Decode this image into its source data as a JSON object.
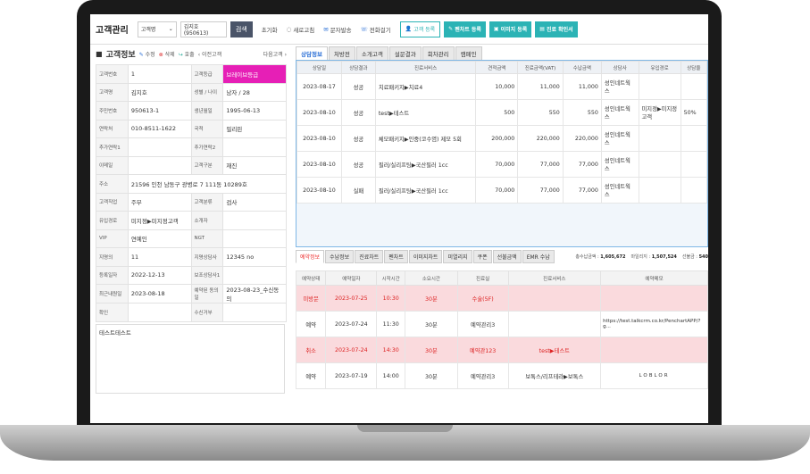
{
  "header": {
    "app_title": "고객관리",
    "search_select": "고객명",
    "search_value": "김지호 (950613)",
    "search_button": "검색",
    "links": [
      "초기화",
      "새로고침",
      "문자발송",
      "전화걸기"
    ],
    "btn_register": "고객 등록",
    "btn_register_rx": "펜차트 등록",
    "btn_image": "이미지 등록",
    "btn_confirm": "진료 확인서"
  },
  "left": {
    "title": "고객정보",
    "edit": "수정",
    "delete": "삭제",
    "transfer": "호출",
    "prev": "이전고객",
    "next": "다음고객",
    "rows": [
      [
        "고객번호",
        "1",
        "고객등급",
        "브레이브등급"
      ],
      [
        "고객명",
        "김지호",
        "성별 / 나이",
        "남자 / 28"
      ],
      [
        "주민번호",
        "950613-1",
        "생년월일",
        "1995-06-13"
      ],
      [
        "연락처",
        "010-8511-1622",
        "국적",
        "필리핀"
      ],
      [
        "추가연락1",
        "",
        "추가연락2",
        ""
      ],
      [
        "이메일",
        "",
        "고객구분",
        "재진"
      ],
      [
        "주소",
        "21596 인천 남동구 광병로 7 111동 10289호",
        "",
        ""
      ],
      [
        "고객직업",
        "주부",
        "고객분류",
        "검사"
      ],
      [
        "유입경로",
        "미지정▶미지정고객",
        "소개자",
        ""
      ],
      [
        "VIP",
        "연예인",
        "NGT",
        ""
      ],
      [
        "지명의",
        "11",
        "지명상담사",
        "12345 no"
      ],
      [
        "등록일자",
        "2022-12-13",
        "보조상담사1",
        ""
      ],
      [
        "최근내원일",
        "2023-08-18",
        "예약된 동의일",
        "2023-08-23_수신동의"
      ],
      [
        "확인",
        "",
        "수신거부",
        ""
      ]
    ],
    "memo": "테스트테스트"
  },
  "upper": {
    "tabs": [
      "상담정보",
      "처방전",
      "소개고객",
      "설문결과",
      "회차관리",
      "캠페인"
    ],
    "columns": [
      "상담일",
      "상담결과",
      "진료서비스",
      "견적금액",
      "진료금액(VAT)",
      "수납금액",
      "상담사",
      "유입경로",
      "상담율"
    ],
    "rows": [
      [
        "2023-08-17",
        "성공",
        "치료패키지▶치료4",
        "10,000",
        "11,000",
        "11,000",
        "성인네트웍스",
        "",
        ""
      ],
      [
        "2023-08-10",
        "성공",
        "test▶테스트",
        "500",
        "550",
        "550",
        "성인네트웍스",
        "미지정▶미지정고객",
        "50%"
      ],
      [
        "2023-08-10",
        "성공",
        "체모패키지▶인중(코수염) 제모 5회",
        "200,000",
        "220,000",
        "220,000",
        "성인네트웍스",
        "",
        ""
      ],
      [
        "2023-08-10",
        "성공",
        "필러/실리프팅▶국산필러 1cc",
        "70,000",
        "77,000",
        "77,000",
        "성인네트웍스",
        "",
        ""
      ],
      [
        "2023-08-10",
        "실패",
        "필러/실리프팅▶국산필러 1cc",
        "70,000",
        "77,000",
        "77,000",
        "성인네트웍스",
        "",
        ""
      ]
    ]
  },
  "lower": {
    "tabs": [
      "예약정보",
      "수납정보",
      "진료차트",
      "펜차트",
      "이미지차트",
      "미열리지",
      "쿠폰",
      "선불금액",
      "EMR 수납"
    ],
    "summary": [
      {
        "label": "총수납금액 :",
        "value": "1,605,672"
      },
      {
        "label": "마일리지 :",
        "value": "1,507,524"
      },
      {
        "label": "선불금 :",
        "value": "540"
      }
    ],
    "columns": [
      "예약상태",
      "예약일자",
      "시작시간",
      "소요시간",
      "진료실",
      "진료서비스",
      "예약메모"
    ],
    "rows": [
      {
        "status": "미방문",
        "date": "2023-07-25",
        "start": "10:30",
        "dur": "30분",
        "room": "수술(5F)",
        "svc": "",
        "memo": "",
        "pink": true
      },
      {
        "status": "예약",
        "date": "2023-07-24",
        "start": "11:30",
        "dur": "30분",
        "room": "예약관리3",
        "svc": "",
        "memo": "https://test.talkcrm.co.kr/PenchartAPP/?g...",
        "pink": false
      },
      {
        "status": "취소",
        "date": "2023-07-24",
        "start": "14:30",
        "dur": "30분",
        "room": "예약관123",
        "svc": "test▶테스트",
        "memo": "",
        "pink": true
      },
      {
        "status": "예약",
        "date": "2023-07-19",
        "start": "14:00",
        "dur": "30분",
        "room": "예약관리3",
        "svc": "보톡스/리프테라▶보톡스",
        "memo": "LOBLOR",
        "pink": false
      }
    ]
  },
  "colors": {
    "teal": "#2bb3b5",
    "grade_bg": "#e61fb6",
    "pink_row": "#fadadd",
    "active_tab": "#2a6fd6"
  }
}
